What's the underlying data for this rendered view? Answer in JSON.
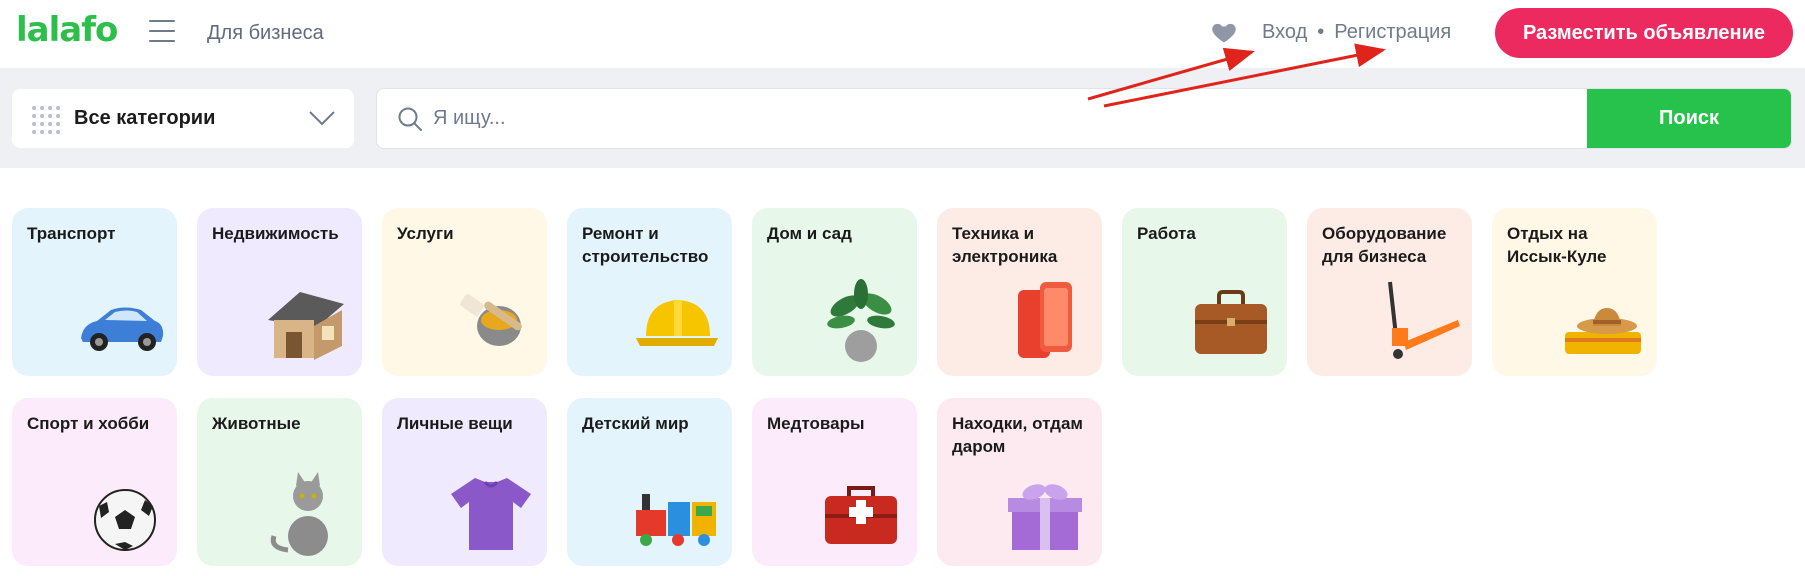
{
  "header": {
    "logo": "lalafo",
    "business_label": "Для бизнеса",
    "login_label": "Вход",
    "separator": "•",
    "register_label": "Регистрация",
    "post_ad_label": "Разместить объявление"
  },
  "search": {
    "category_label": "Все категории",
    "placeholder": "Я ищу...",
    "button_label": "Поиск"
  },
  "categories": [
    {
      "label": "Транспорт",
      "bg": "#e3f4fd",
      "icon": "car-icon"
    },
    {
      "label": "Недвижимость",
      "bg": "#efeafd",
      "icon": "house-icon"
    },
    {
      "label": "Услуги",
      "bg": "#fff8e6",
      "icon": "paint-brush-icon"
    },
    {
      "label": "Ремонт и строительство",
      "bg": "#e3f4fd",
      "icon": "hard-hat-icon"
    },
    {
      "label": "Дом и сад",
      "bg": "#e7f7ea",
      "icon": "plant-icon"
    },
    {
      "label": "Техника и электроника",
      "bg": "#fdece6",
      "icon": "smartphone-icon"
    },
    {
      "label": "Работа",
      "bg": "#e7f7ea",
      "icon": "briefcase-icon"
    },
    {
      "label": "Оборудование для бизнеса",
      "bg": "#fdece6",
      "icon": "pallet-jack-icon"
    },
    {
      "label": "Отдых на Иссык-Куле",
      "bg": "#fff8e6",
      "icon": "beach-hat-icon"
    },
    {
      "label": "Спорт и хобби",
      "bg": "#fcebfb",
      "icon": "soccer-ball-icon"
    },
    {
      "label": "Животные",
      "bg": "#e7f7ea",
      "icon": "cat-icon"
    },
    {
      "label": "Личные вещи",
      "bg": "#efeafd",
      "icon": "t-shirt-icon"
    },
    {
      "label": "Детский мир",
      "bg": "#e3f4fd",
      "icon": "toy-train-icon"
    },
    {
      "label": "Медтовары",
      "bg": "#fcebfb",
      "icon": "first-aid-kit-icon"
    },
    {
      "label": "Находки, отдам даром",
      "bg": "#fdeaf0",
      "icon": "gift-icon"
    }
  ],
  "colors": {
    "brand_green": "#2cc04a",
    "post_button": "#ed2a5f",
    "search_button": "#27c24c",
    "annotation_arrow": "#e0241b"
  }
}
